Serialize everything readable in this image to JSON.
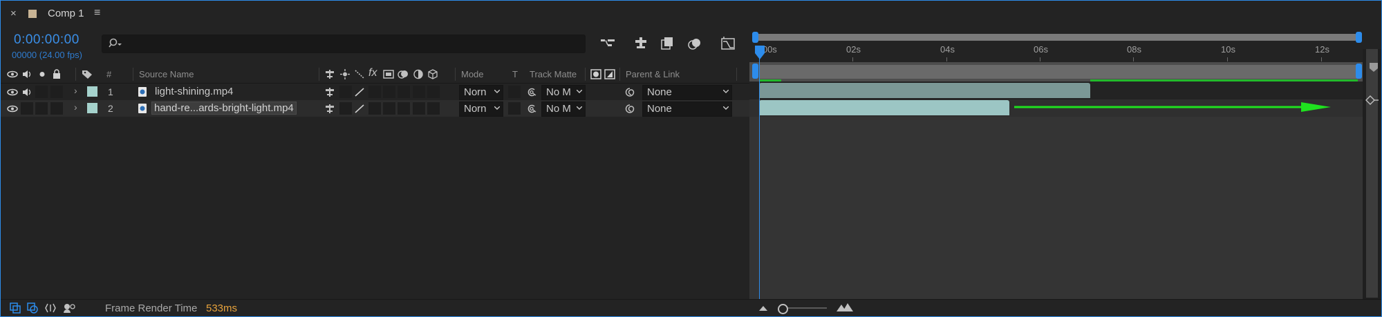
{
  "tab": {
    "close": "×",
    "title": "Comp 1",
    "menu": "≡"
  },
  "panel": {
    "timecode": "0:00:00:00",
    "fps": "00000 (24.00 fps)",
    "search_placeholder": "",
    "search_icon": "search-icon"
  },
  "columns": {
    "number": "#",
    "source_name": "Source Name",
    "mode": "Mode",
    "t": "T",
    "track_matte": "Track Matte",
    "parent_link": "Parent & Link",
    "fx": "fx"
  },
  "layers": [
    {
      "number": "1",
      "source_name": "light-shining.mp4",
      "mode": "Norn",
      "track_matte": "No M",
      "parent": "None"
    },
    {
      "number": "2",
      "source_name": "hand-re...ards-bright-light.mp4",
      "mode": "Norn",
      "track_matte": "No M",
      "parent": "None"
    }
  ],
  "timeline": {
    "ticks": [
      "0s",
      "02s",
      "04s",
      "06s",
      "08s",
      "10s",
      "12s"
    ],
    "tick_start_label": "0:00s"
  },
  "footer": {
    "frame_render_label": "Frame Render Time",
    "frame_render_value": "533ms"
  },
  "colors": {
    "accent": "#2d8ceb",
    "label_aqua": "#a5d2cc",
    "render_value": "#e8a33c",
    "green_work": "#22b92b"
  }
}
